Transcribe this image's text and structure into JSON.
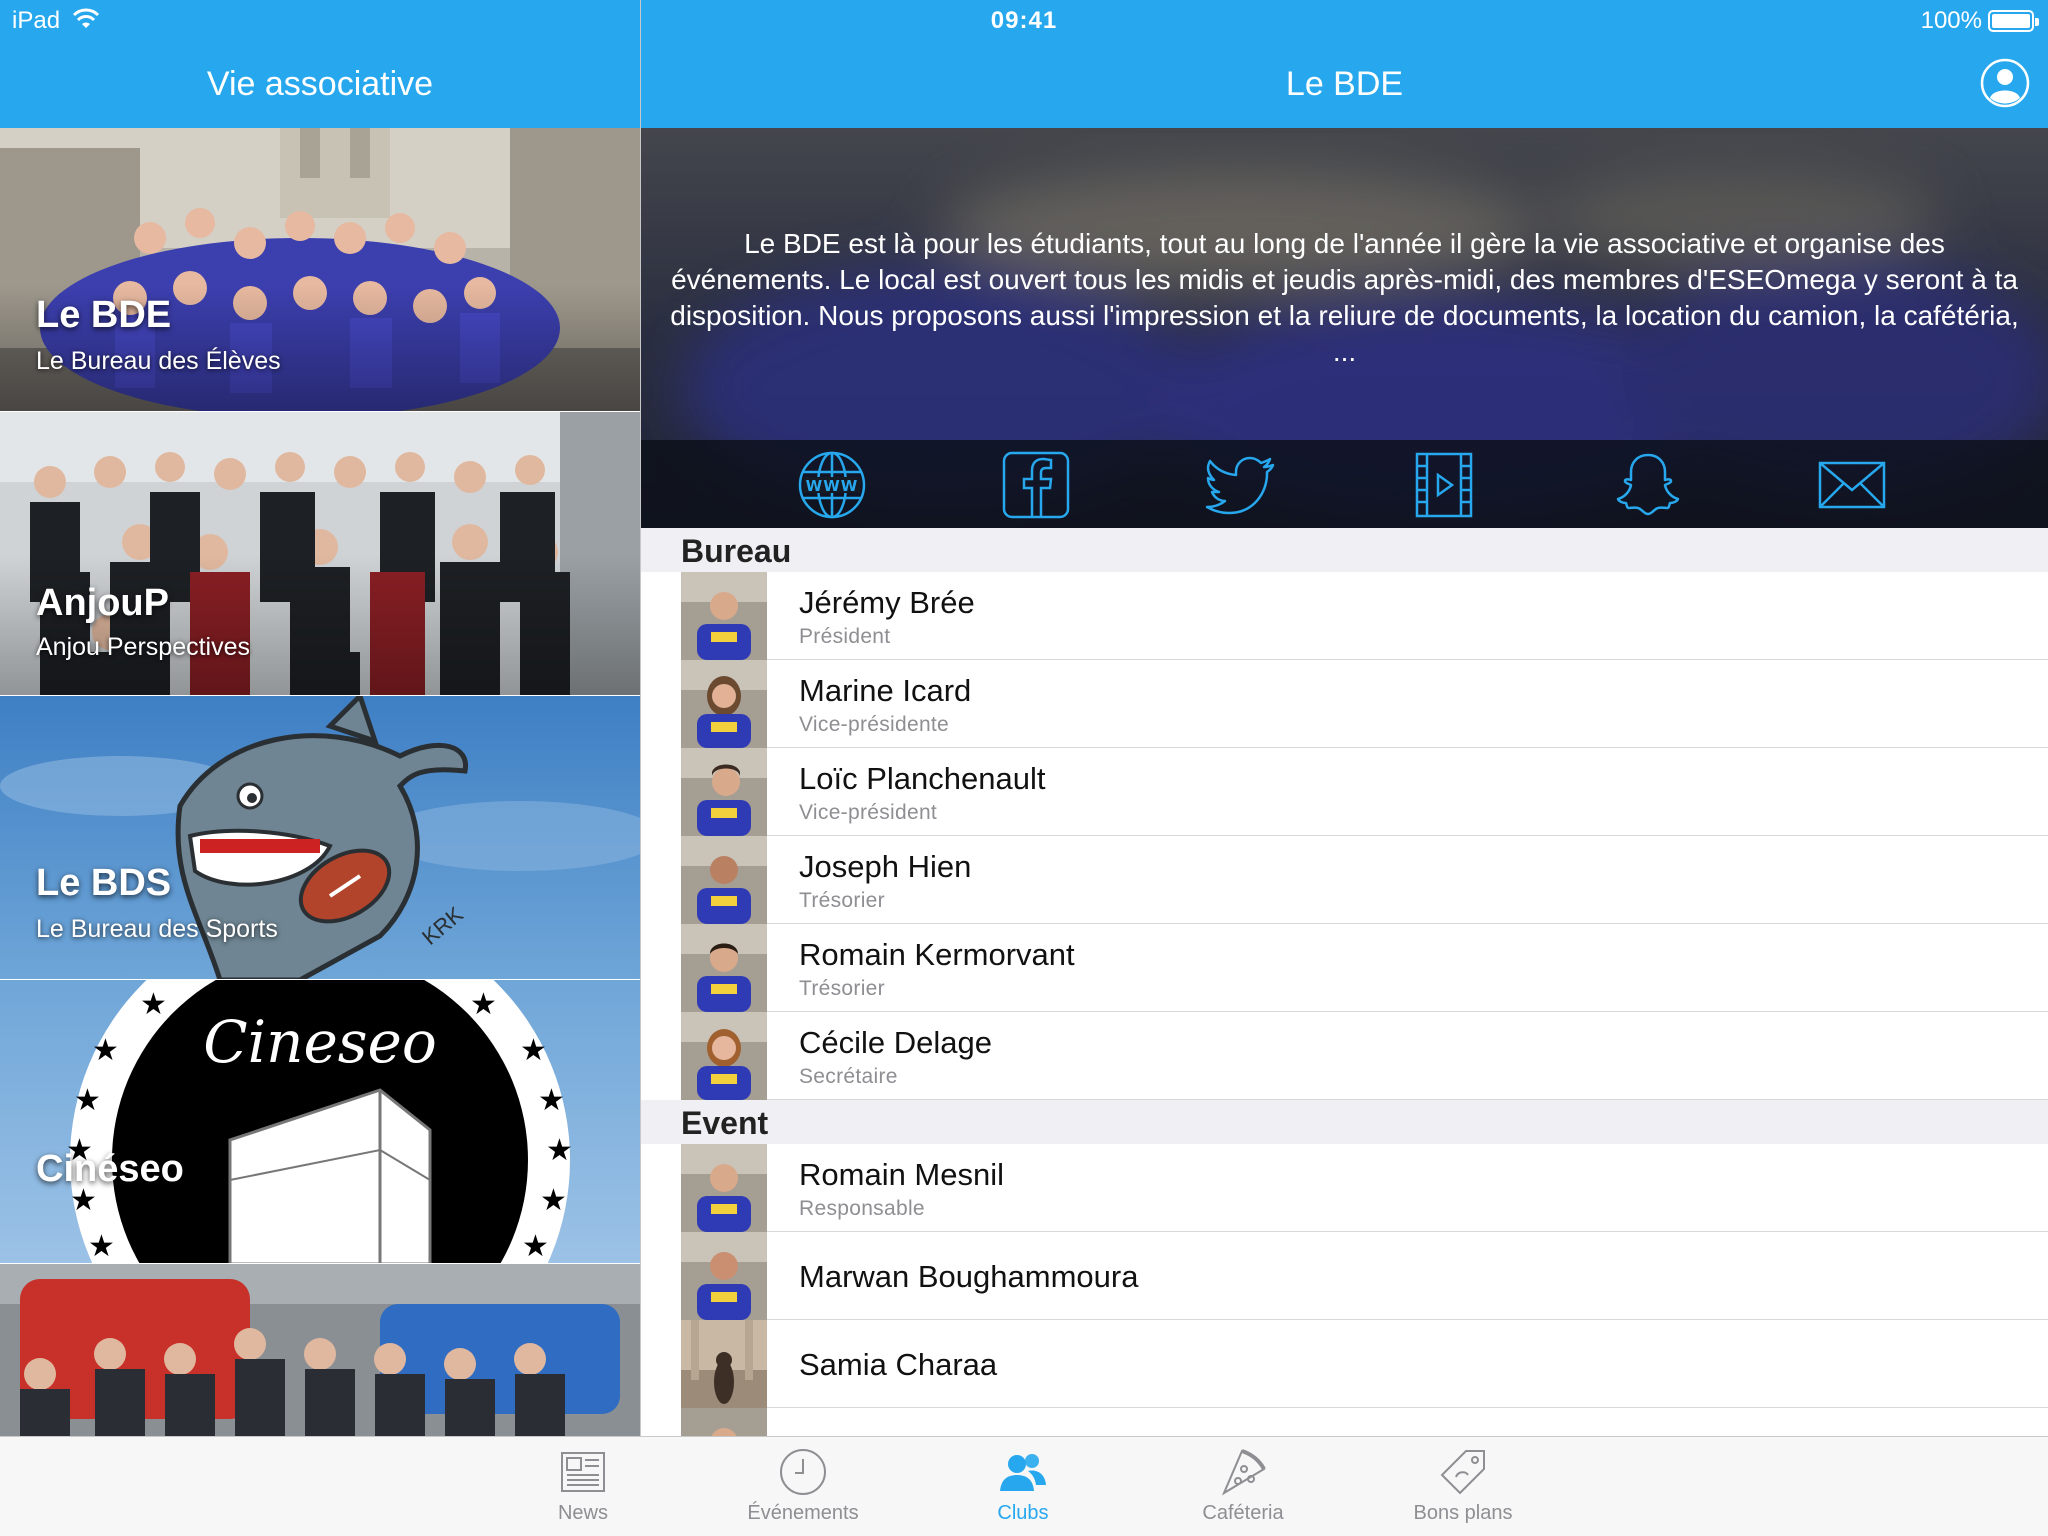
{
  "status_bar": {
    "device": "iPad",
    "time": "09:41",
    "battery": "100%"
  },
  "left_nav": {
    "title": "Vie associative"
  },
  "right_nav": {
    "title": "Le BDE"
  },
  "clubs": [
    {
      "name": "Le BDE",
      "subtitle": "Le Bureau des Élèves"
    },
    {
      "name": "AnjouP",
      "subtitle": "Anjou Perspectives"
    },
    {
      "name": "Le BDS",
      "subtitle": "Le Bureau des Sports"
    },
    {
      "name": "Cinéseo",
      "subtitle": "",
      "logo_text": "Cineseo"
    }
  ],
  "club_detail": {
    "description": "Le BDE est là pour les étudiants, tout au long de l'année il gère la vie associative et organise des événements. Le local est ouvert tous les midis et jeudis après-midi, des membres d'ESEOmega y seront à ta disposition. Nous proposons aussi l'impression et la reliure de documents, la location du camion, la cafétéria, ...",
    "social_links": [
      "web-icon",
      "facebook-icon",
      "twitter-icon",
      "video-icon",
      "snapchat-icon",
      "mail-icon"
    ],
    "sections": [
      {
        "title": "Bureau",
        "members": [
          {
            "name": "Jérémy Brée",
            "role": "Président"
          },
          {
            "name": "Marine Icard",
            "role": "Vice-présidente"
          },
          {
            "name": "Loïc Planchenault",
            "role": "Vice-président"
          },
          {
            "name": "Joseph Hien",
            "role": "Trésorier"
          },
          {
            "name": "Romain Kermorvant",
            "role": "Trésorier"
          },
          {
            "name": "Cécile Delage",
            "role": "Secrétaire"
          }
        ]
      },
      {
        "title": "Event",
        "members": [
          {
            "name": "Romain Mesnil",
            "role": "Responsable"
          },
          {
            "name": "Marwan Boughammoura",
            "role": ""
          },
          {
            "name": "Samia Charaa",
            "role": ""
          }
        ]
      }
    ]
  },
  "tabs": [
    {
      "label": "News",
      "icon": "newspaper-icon",
      "active": false
    },
    {
      "label": "Événements",
      "icon": "clock-icon",
      "active": false
    },
    {
      "label": "Clubs",
      "icon": "people-icon",
      "active": true
    },
    {
      "label": "Caféteria",
      "icon": "pizza-icon",
      "active": false
    },
    {
      "label": "Bons plans",
      "icon": "tag-icon",
      "active": false
    }
  ],
  "colors": {
    "accent": "#27a8ee",
    "inactive": "#8e8e93",
    "section_bg": "#efeff4"
  }
}
